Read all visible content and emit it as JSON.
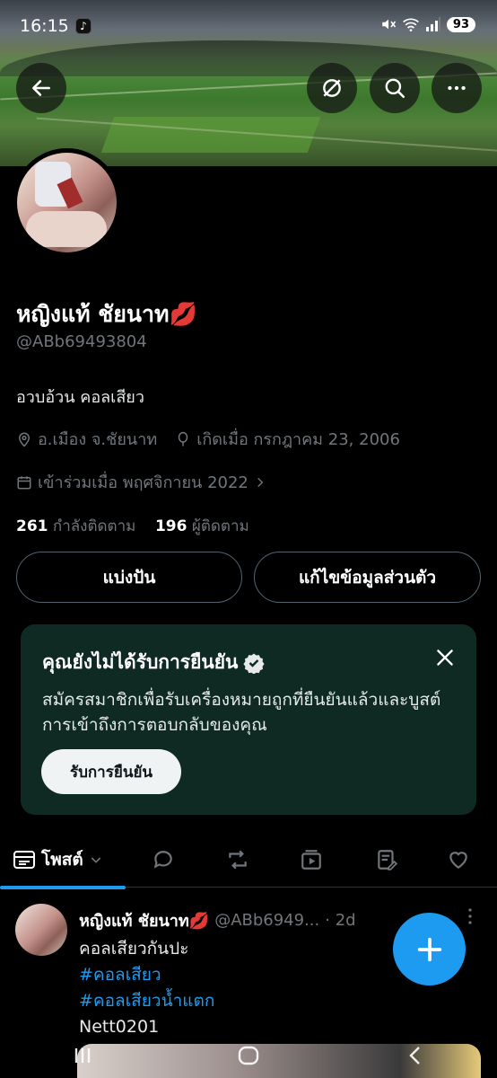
{
  "status_bar": {
    "time": "16:15",
    "battery": "93",
    "icons": [
      "tiktok-icon",
      "mute-icon",
      "wifi-icon",
      "signal-icon",
      "battery-icon"
    ]
  },
  "header": {
    "back_icon": "arrow-left-icon",
    "grok_icon": "grok-icon",
    "search_icon": "search-icon",
    "more_icon": "more-horizontal-icon"
  },
  "profile": {
    "display_name": "หญิงแท้ ชัยนาท💋",
    "handle": "@ABb69493804",
    "bio": "อวบอ้วน คอลเสียว",
    "location": "อ.เมือง จ.ชัยนาท",
    "birthday": "เกิดเมื่อ กรกฎาคม 23, 2006",
    "joined": "เข้าร่วมเมื่อ พฤศจิกายน 2022",
    "following_count": "261",
    "following_label": "กำลังติดตาม",
    "followers_count": "196",
    "followers_label": "ผู้ติดตาม"
  },
  "actions": {
    "share_label": "แบ่งปัน",
    "edit_label": "แก้ไขข้อมูลส่วนตัว"
  },
  "verify_card": {
    "title": "คุณยังไม่ได้รับการยืนยัน",
    "description": "สมัครสมาชิกเพื่อรับเครื่องหมายถูกที่ยืนยันแล้วและบูสต์การเข้าถึงการตอบกลับของคุณ",
    "button_label": "รับการยืนยัน"
  },
  "tabs": {
    "posts_label": "โพสต์",
    "icons": [
      "posts-icon",
      "replies-icon",
      "reposts-icon",
      "media-icon",
      "articles-icon",
      "likes-icon"
    ]
  },
  "post": {
    "name": "หญิงแท้ ชัยนาท💋",
    "handle": "@ABb6949...",
    "time": "· 2d",
    "line1": "คอลเสียวกันปะ",
    "tag1": "#คอลเสียว",
    "tag2": "#คอลเสียวน้ำแตก",
    "line4": "Nett0201"
  },
  "colors": {
    "accent": "#1d9bf0",
    "verify_bg": "#0e2a22",
    "muted": "#71767b"
  }
}
